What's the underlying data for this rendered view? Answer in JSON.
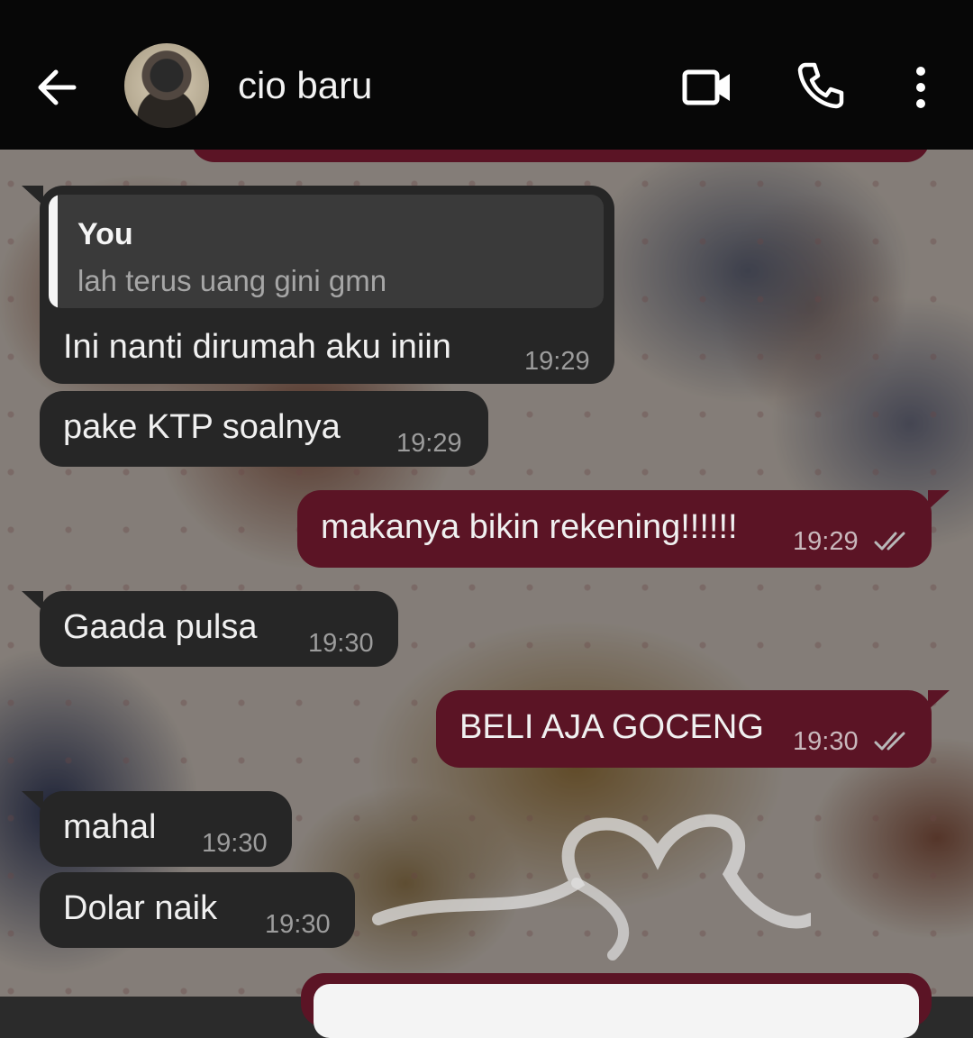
{
  "header": {
    "contact_name": "cio baru"
  },
  "icons": {
    "back": "arrow-left-icon",
    "video": "video-camera-icon",
    "call": "phone-icon",
    "menu": "more-vertical-icon"
  },
  "colors": {
    "header_bg": "#070707",
    "incoming_bubble": "#262626",
    "outgoing_bubble": "#5b1425",
    "read_ticks": "#b8b8b8"
  },
  "messages": [
    {
      "direction": "incoming",
      "reply_to": {
        "author": "You",
        "text": "lah terus uang gini gmn"
      },
      "text": "Ini nanti dirumah aku iniin",
      "time": "19:29"
    },
    {
      "direction": "incoming",
      "text": "pake KTP soalnya",
      "time": "19:29"
    },
    {
      "direction": "outgoing",
      "text": "makanya bikin rekening!!!!!!",
      "time": "19:29",
      "status": "read"
    },
    {
      "direction": "incoming",
      "text": "Gaada pulsa",
      "time": "19:30"
    },
    {
      "direction": "outgoing",
      "text": "BELI AJA GOCENG",
      "time": "19:30",
      "status": "read"
    },
    {
      "direction": "incoming",
      "text": "mahal",
      "time": "19:30"
    },
    {
      "direction": "incoming",
      "text": "Dolar naik",
      "time": "19:30"
    }
  ]
}
